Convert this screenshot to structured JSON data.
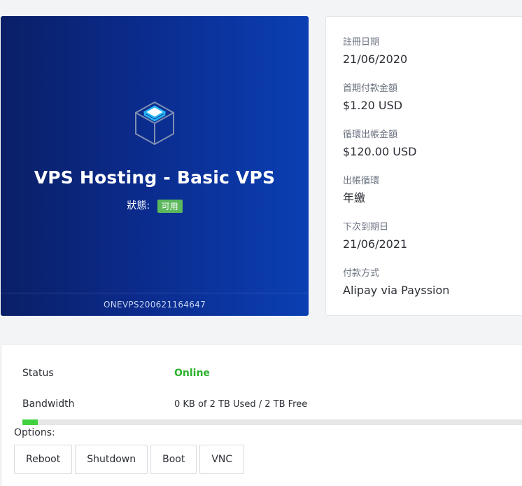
{
  "product": {
    "icon": "cube-icon",
    "title": "VPS Hosting - Basic VPS",
    "status_label": "狀態:",
    "status_value": "可用",
    "status_color": "#5cb85c",
    "service_id": "ONEVPS200621164647",
    "gradient_start": "#0a1f66",
    "gradient_end": "#0b3fb3"
  },
  "info": [
    {
      "label": "註冊日期",
      "value": "21/06/2020"
    },
    {
      "label": "首期付款金額",
      "value": "$1.20 USD"
    },
    {
      "label": "循環出帳金額",
      "value": "$120.00 USD"
    },
    {
      "label": "出帳循環",
      "value": "年繳"
    },
    {
      "label": "下次到期日",
      "value": "21/06/2021"
    },
    {
      "label": "付款方式",
      "value": "Alipay via Payssion"
    }
  ],
  "details": {
    "status_label": "Status",
    "status_value": "Online",
    "status_color": "#2bb22b",
    "bandwidth_label": "Bandwidth",
    "bandwidth_value": "0 KB of 2 TB Used / 2 TB Free",
    "bandwidth_fraction": 0.03,
    "options_label": "Options:",
    "buttons": [
      "Reboot",
      "Shutdown",
      "Boot",
      "VNC"
    ]
  }
}
